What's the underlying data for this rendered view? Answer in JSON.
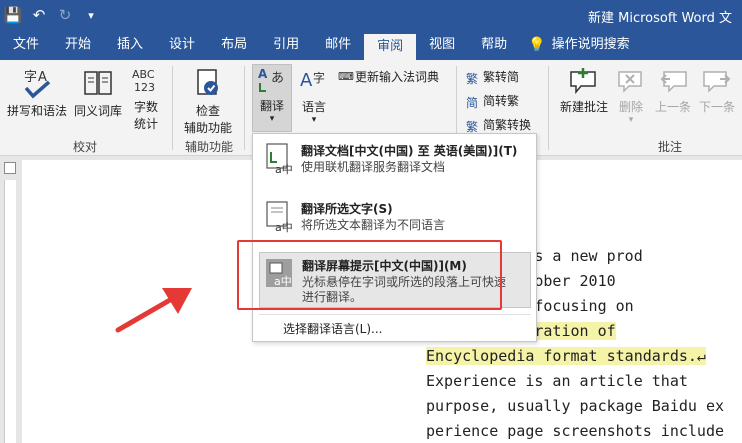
{
  "title": "新建 Microsoft Word 文",
  "tabs": [
    "文件",
    "开始",
    "插入",
    "设计",
    "布局",
    "引用",
    "邮件",
    "审阅",
    "视图",
    "帮助"
  ],
  "tell_me": "操作说明搜索",
  "ribbon": {
    "proofing": {
      "spell": "拼写和语法",
      "thesaurus": "同义词库",
      "wordcount_l1": "字数",
      "wordcount_l2": "统计",
      "wordcount_icon_text": "ABC\n123",
      "label": "校对"
    },
    "accessibility": {
      "check_l1": "检查",
      "check_l2": "辅助功能",
      "label": "辅助功能"
    },
    "language": {
      "translate": "翻译",
      "language": "语言",
      "update_ime": "更新输入法词典"
    },
    "chinese": {
      "t2s": "繁转简",
      "s2t": "简转繁",
      "convert": "简繁转换"
    },
    "comments": {
      "new": "新建批注",
      "delete": "删除",
      "prev": "上一条",
      "next": "下一条",
      "label": "批注"
    }
  },
  "menu": {
    "item1_title": "翻译文档[中文(中国) 至 英语(美国)](T)",
    "item1_desc": "使用联机翻译服务翻译文档",
    "item2_title": "翻译所选文字(S)",
    "item2_desc": "将所选文本翻译为不同语言",
    "item3_title": "翻译屏幕提示[中文(中国)](M)",
    "item3_desc": "光标悬停在字词或所选的段落上可快速进行翻译。",
    "choose_lang": "选择翻译语言(L)..."
  },
  "document": {
    "lines": [
      "Experience is a new prod",
      " Baidu in October 2010",
      "how to do\", focusing on",
      "e, the integration of",
      "Encyclopedia format standards.↵",
      "  Experience is an article that",
      "purpose, usually package Baidu ex",
      "perience page screenshots include"
    ]
  },
  "colors": {
    "accent": "#2b579a",
    "highlight": "#f4f3a8",
    "annotation": "#e53935"
  }
}
